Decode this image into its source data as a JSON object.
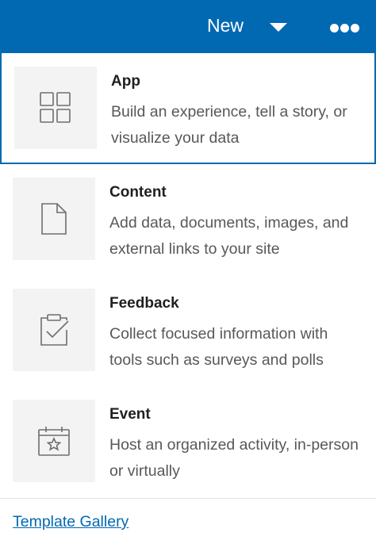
{
  "header": {
    "new_label": "New",
    "dropdown_icon": "caret-down-icon",
    "more_icon": "ellipsis-icon"
  },
  "menu": {
    "items": [
      {
        "title": "App",
        "description": "Build an experience, tell a story, or visualize your data",
        "icon": "grid-icon",
        "selected": true
      },
      {
        "title": "Content",
        "description": "Add data, documents, images, and external links to your site",
        "icon": "document-icon",
        "selected": false
      },
      {
        "title": "Feedback",
        "description": "Collect focused information with tools such as surveys and polls",
        "icon": "clipboard-check-icon",
        "selected": false
      },
      {
        "title": "Event",
        "description": "Host an organized activity, in-person or virtually",
        "icon": "calendar-star-icon",
        "selected": false
      }
    ]
  },
  "footer": {
    "link_label": "Template Gallery"
  },
  "colors": {
    "brand": "#0069b2",
    "icon_background": "#f3f3f3",
    "icon_stroke": "#6e6e6e",
    "title_text": "#1f1f1f",
    "description_text": "#585858"
  }
}
